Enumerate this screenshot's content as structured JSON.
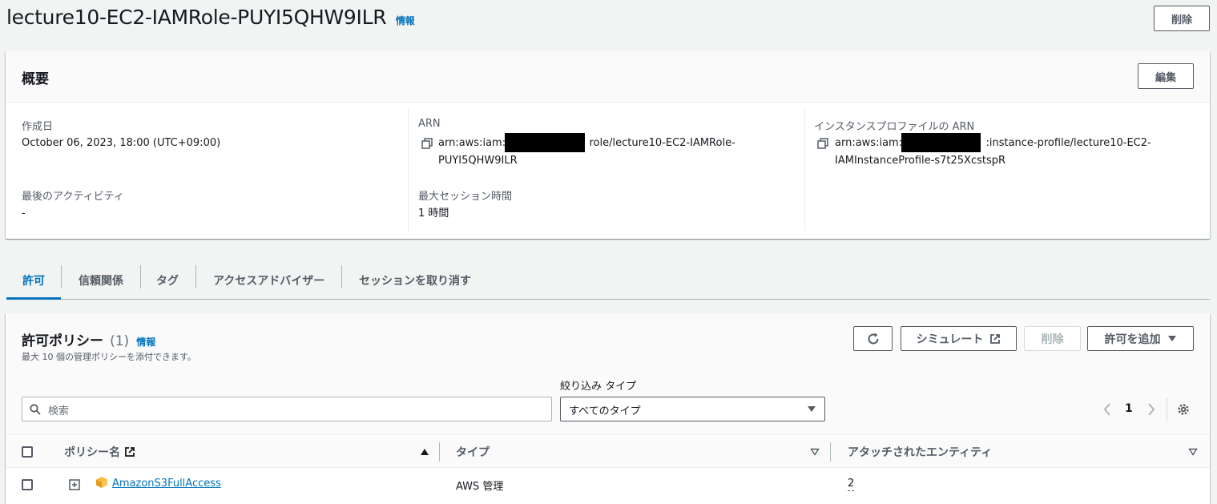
{
  "header": {
    "title": "lecture10-EC2-IAMRole-PUYI5QHW9ILR",
    "info": "情報",
    "delete_label": "削除"
  },
  "summary": {
    "heading": "概要",
    "edit_label": "編集",
    "created_label": "作成日",
    "created_value": "October 06, 2023, 18:00 (UTC+09:00)",
    "last_activity_label": "最後のアクティビティ",
    "last_activity_value": "-",
    "arn_label": "ARN",
    "arn_prefix": "arn:aws:iam::",
    "arn_suffix": "role/lecture10-EC2-IAMRole-",
    "arn_line2": "PUYI5QHW9ILR",
    "max_session_label": "最大セッション時間",
    "max_session_value": "1 時間",
    "instance_profile_label": "インスタンスプロファイルの ARN",
    "ip_prefix": "arn:aws:iam::",
    "ip_suffix": ":instance-profile/lecture10-EC2-",
    "ip_line2": "IAMInstanceProfile-s7t25XcstspR"
  },
  "tabs": [
    {
      "label": "許可",
      "active": true
    },
    {
      "label": "信頼関係"
    },
    {
      "label": "タグ"
    },
    {
      "label": "アクセスアドバイザー"
    },
    {
      "label": "セッションを取り消す"
    }
  ],
  "policies": {
    "heading": "許可ポリシー",
    "count": "(1)",
    "info": "情報",
    "description": "最大 10 個の管理ポリシーを添付できます。",
    "simulate_label": "シミュレート",
    "delete_label": "削除",
    "add_label": "許可を追加",
    "filter_type_label": "絞り込み タイプ",
    "search_placeholder": "検索",
    "type_select_value": "すべてのタイプ",
    "page_number": "1",
    "columns": {
      "name": "ポリシー名",
      "type": "タイプ",
      "entities": "アタッチされたエンティティ"
    },
    "rows": [
      {
        "name": "AmazonS3FullAccess",
        "type": "AWS 管理",
        "entities": "2"
      }
    ]
  }
}
